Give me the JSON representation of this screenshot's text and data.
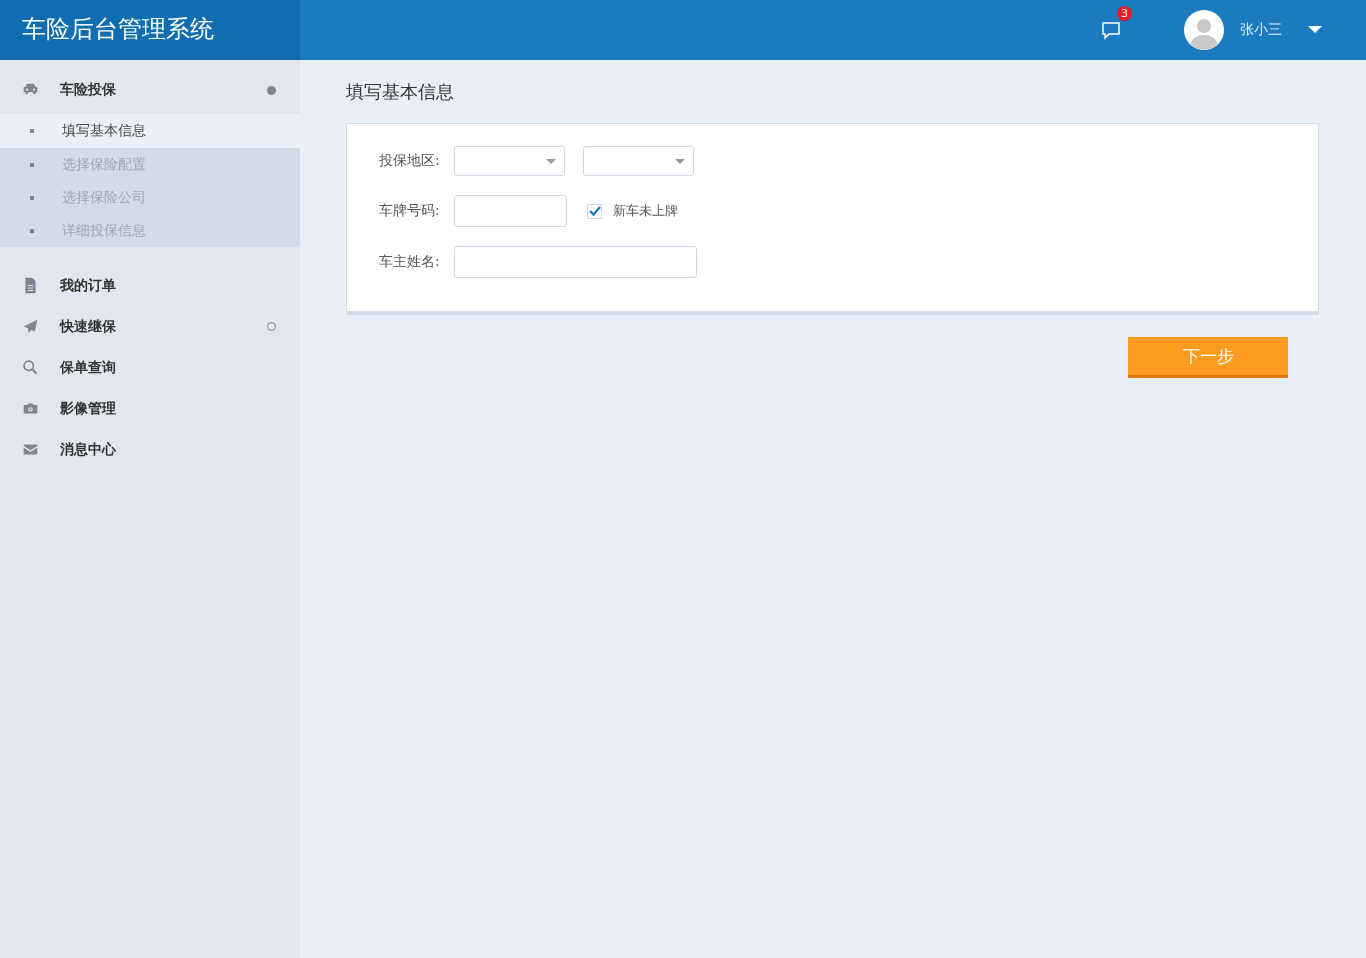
{
  "header": {
    "title": "车险后台管理系统",
    "message_badge": "3",
    "user_name": "张小三"
  },
  "sidebar": {
    "items": [
      {
        "kind": "car",
        "label": "车险投保",
        "expanded": true,
        "children": [
          {
            "label": "填写基本信息",
            "selected": true
          },
          {
            "label": "选择保险配置",
            "selected": false
          },
          {
            "label": "选择保险公司",
            "selected": false
          },
          {
            "label": "详细投保信息",
            "selected": false
          }
        ]
      },
      {
        "kind": "document",
        "label": "我的订单"
      },
      {
        "kind": "send",
        "label": "快速继保",
        "expanded": false
      },
      {
        "kind": "search",
        "label": "保单查询"
      },
      {
        "kind": "camera",
        "label": "影像管理"
      },
      {
        "kind": "mail",
        "label": "消息中心"
      }
    ]
  },
  "page_title": "填写基本信息",
  "form": {
    "rows": [
      {
        "kind": "selects",
        "label": "投保地区:",
        "dropdowns": [
          {
            "open": false
          },
          {
            "open": false
          }
        ]
      },
      {
        "kind": "plate",
        "label": "车牌号码:",
        "checkbox": {
          "label": "新车未上牌",
          "checked": true
        }
      },
      {
        "kind": "text",
        "label": "车主姓名:"
      }
    ]
  },
  "next_button": "下一步"
}
